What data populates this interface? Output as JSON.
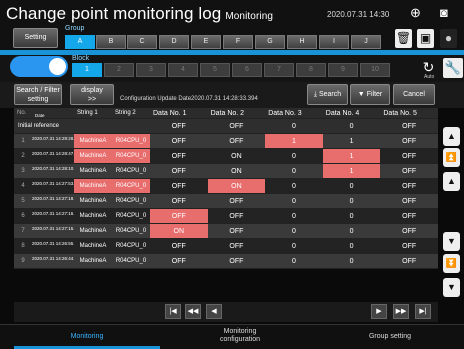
{
  "header": {
    "title": "Change point monitoring log",
    "subtitle": "Monitoring",
    "datetime": "2020.07.31 14:30",
    "globe_icon": "⊕",
    "camera_icon": "◙"
  },
  "groups": {
    "setting_label": "Setting",
    "group_label": "Group",
    "items": [
      "A",
      "B",
      "C",
      "D",
      "E",
      "F",
      "G",
      "H",
      "I",
      "J"
    ],
    "active": "A"
  },
  "blocks": {
    "block_label": "Block",
    "items": [
      "1",
      "2",
      "3",
      "4",
      "5",
      "6",
      "7",
      "8",
      "9",
      "10"
    ],
    "active": "1",
    "auto_label": "Auto"
  },
  "toolbar": {
    "search_filter_label": "Search / Filter\nsetting",
    "display_label": "display\n>>",
    "config_update": "Configuration Update Date2020.07.31 14:28:33.394",
    "search_label": "Search",
    "filter_label": "Filter",
    "cancel_label": "Cancel"
  },
  "table": {
    "headers": [
      "No.",
      "Date",
      "String 1",
      "String 2",
      "Data No. 1",
      "Data No. 2",
      "Data No. 3",
      "Data No. 4",
      "Data No. 5"
    ],
    "ref_label": "Initial reference",
    "ref_values": [
      "OFF",
      "OFF",
      "0",
      "0",
      "OFF"
    ],
    "rows": [
      {
        "no": "1",
        "date": "2020.07.31 14:29:28.308",
        "s1": "MachineA",
        "s2": "R04CPU_0",
        "d": [
          "OFF",
          "OFF",
          "1",
          "1",
          "OFF"
        ],
        "hl": [
          false,
          false,
          true,
          false,
          false
        ],
        "s_hl": true
      },
      {
        "no": "2",
        "date": "2020.07.31 14:28:47.696",
        "s1": "MachineA",
        "s2": "R04CPU_0",
        "d": [
          "OFF",
          "ON",
          "0",
          "1",
          "OFF"
        ],
        "hl": [
          false,
          false,
          false,
          true,
          false
        ],
        "s_hl": true
      },
      {
        "no": "3",
        "date": "2020.07.31 14:28:10.410",
        "s1": "MachineA",
        "s2": "R04CPU_0",
        "d": [
          "OFF",
          "ON",
          "0",
          "1",
          "OFF"
        ],
        "hl": [
          false,
          false,
          false,
          true,
          false
        ],
        "s_hl": false
      },
      {
        "no": "4",
        "date": "2020.07.31 14:27:53.341",
        "s1": "MachineA",
        "s2": "R04CPU_0",
        "d": [
          "OFF",
          "ON",
          "0",
          "0",
          "OFF"
        ],
        "hl": [
          false,
          true,
          false,
          false,
          false
        ],
        "s_hl": true
      },
      {
        "no": "5",
        "date": "2020.07.31 14:27:18.718",
        "s1": "MachineA",
        "s2": "R04CPU_0",
        "d": [
          "OFF",
          "OFF",
          "0",
          "0",
          "OFF"
        ],
        "hl": [
          false,
          false,
          false,
          false,
          false
        ],
        "s_hl": false
      },
      {
        "no": "6",
        "date": "2020.07.31 14:27:16.703",
        "s1": "MachineA",
        "s2": "R04CPU_0",
        "d": [
          "OFF",
          "OFF",
          "0",
          "0",
          "OFF"
        ],
        "hl": [
          true,
          false,
          false,
          false,
          false
        ],
        "s_hl": false
      },
      {
        "no": "7",
        "date": "2020.07.31 14:27:15.197",
        "s1": "MachineA",
        "s2": "R04CPU_0",
        "d": [
          "ON",
          "OFF",
          "0",
          "0",
          "OFF"
        ],
        "hl": [
          true,
          false,
          false,
          false,
          false
        ],
        "s_hl": false
      },
      {
        "no": "8",
        "date": "2020.07.31 14:26:55.102",
        "s1": "MachineA",
        "s2": "R04CPU_0",
        "d": [
          "OFF",
          "OFF",
          "0",
          "0",
          "OFF"
        ],
        "hl": [
          false,
          false,
          false,
          false,
          false
        ],
        "s_hl": false
      },
      {
        "no": "9",
        "date": "2020.07.31 14:26:44.041",
        "s1": "MachineA",
        "s2": "R04CPU_0",
        "d": [
          "OFF",
          "OFF",
          "0",
          "0",
          "OFF"
        ],
        "hl": [
          false,
          false,
          false,
          false,
          false
        ],
        "s_hl": false
      }
    ]
  },
  "bottom": {
    "monitoring": "Monitoring",
    "monitoring_config": "Monitoring\nconfiguration",
    "group_setting": "Group setting"
  },
  "colors": {
    "accent": "#1993d8",
    "highlight": "#e86d6d"
  }
}
